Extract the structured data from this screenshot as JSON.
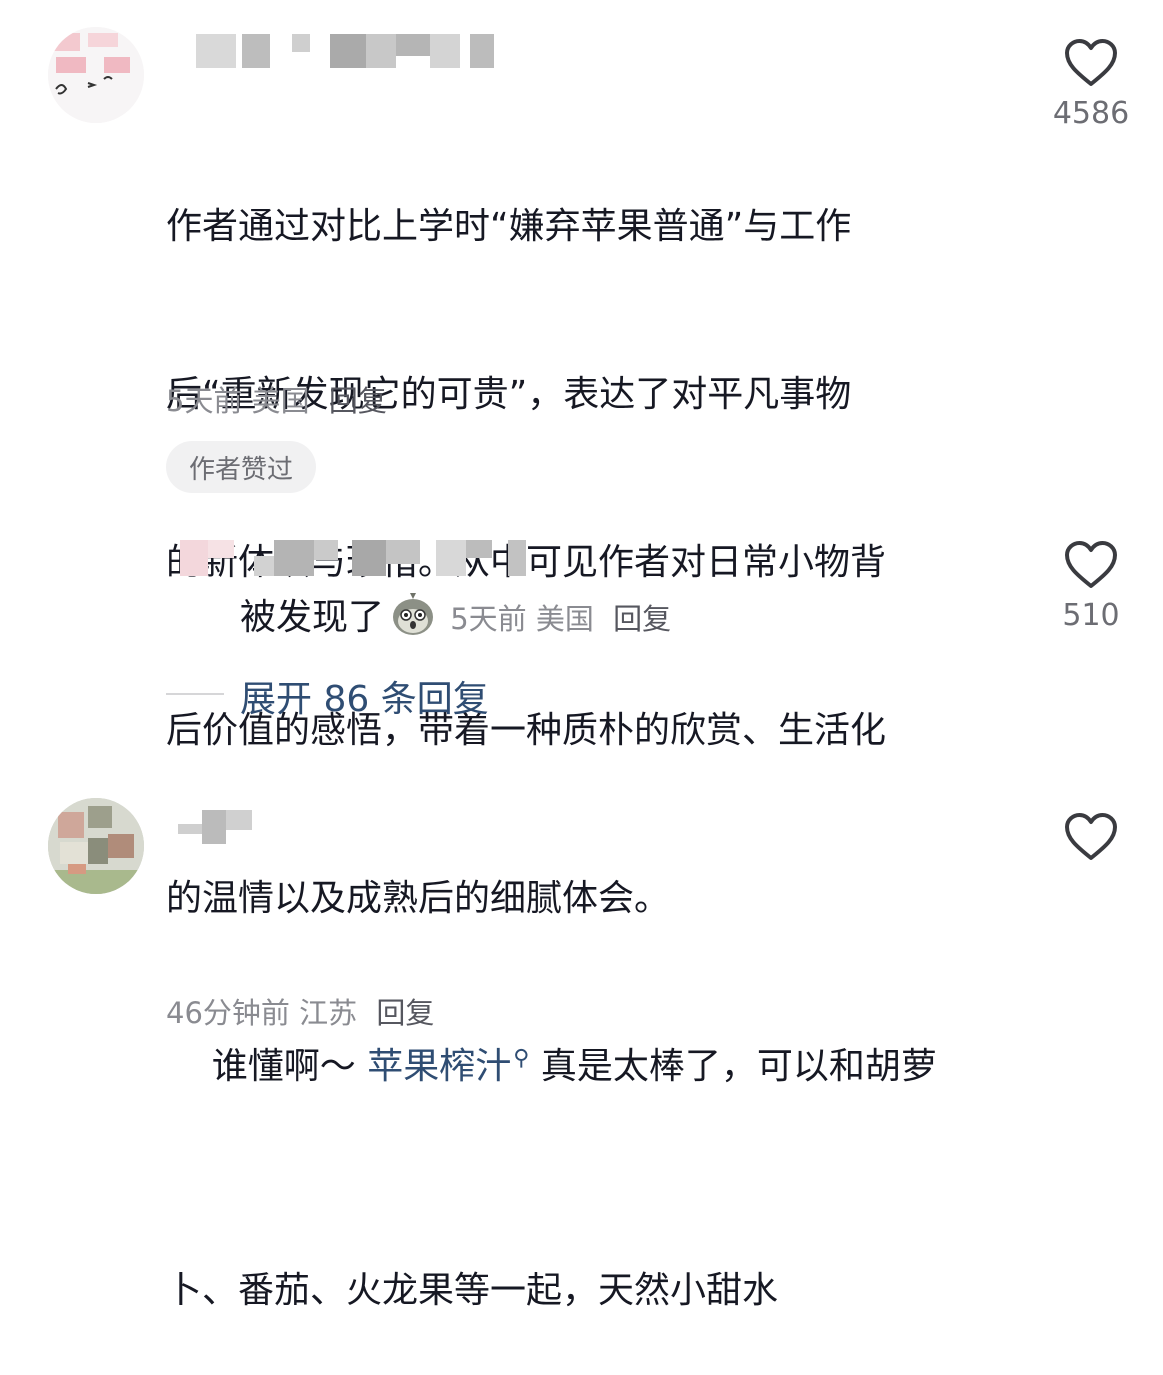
{
  "comments": [
    {
      "text_lines": [
        "作者通过对比上学时“嫌弃苹果普通”与工作",
        "后“重新发现它的可贵”，表达了对平凡事物",
        "的新体认与珍惜。从中可见作者对日常小物背",
        "后价值的感悟，带着一种质朴的欣赏、生活化",
        "的温情以及成熟后的细腻体会。"
      ],
      "time": "5天前",
      "location": "美国",
      "reply_label": "回复",
      "badge": "作者赞过",
      "likes": "4586",
      "replies": [
        {
          "text": "被发现了",
          "time": "5天前",
          "location": "美国",
          "reply_label": "回复",
          "likes": "510"
        }
      ],
      "expand_label": "展开 86 条回复"
    },
    {
      "text_prefix": "谁懂啊～ ",
      "topic": "苹果榨汁",
      "text_line1_suffix": " 真是太棒了，可以和胡萝",
      "text_line2": "卜、番茄、火龙果等一起，天然小甜水",
      "time": "46分钟前",
      "location": "江苏",
      "reply_label": "回复"
    }
  ],
  "icons": {
    "like": "heart-outline-icon",
    "emoji": "ghost-emoji-icon",
    "topic_search": "search-icon"
  },
  "colors": {
    "text": "#161823",
    "meta": "#8a8b91",
    "link": "#2f4d73",
    "badge_bg": "#f1f1f2"
  }
}
